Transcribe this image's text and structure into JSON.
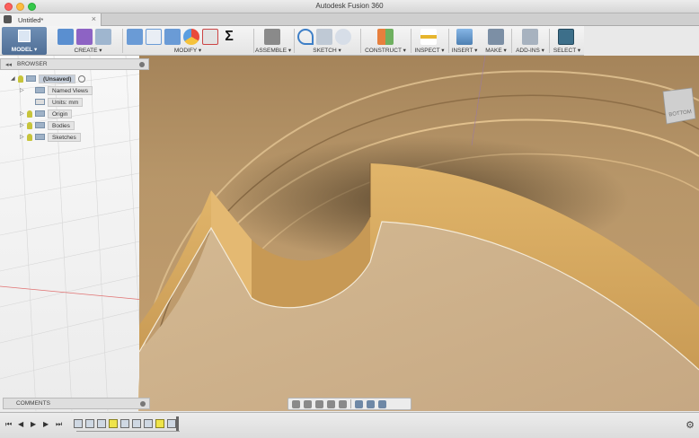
{
  "window": {
    "title": "Autodesk Fusion 360"
  },
  "tab": {
    "name": "Untitled*",
    "close": "×"
  },
  "workspace": {
    "label": "MODEL ▾"
  },
  "toolbar_groups": [
    {
      "label": "CREATE ▾"
    },
    {
      "label": "MODIFY ▾"
    },
    {
      "label": "ASSEMBLE ▾"
    },
    {
      "label": "SKETCH ▾"
    },
    {
      "label": "CONSTRUCT ▾"
    },
    {
      "label": "INSPECT ▾"
    },
    {
      "label": "INSERT ▾"
    },
    {
      "label": "MAKE ▾"
    },
    {
      "label": "ADD-INS ▾"
    },
    {
      "label": "SELECT ▾"
    }
  ],
  "toolbar_glyphs": {
    "sigma": "Σ"
  },
  "browser": {
    "title": "BROWSER",
    "collapse": "◂◂",
    "root": "(Unsaved)",
    "items": [
      {
        "label": "Named Views"
      },
      {
        "label": "Units: mm"
      },
      {
        "label": "Origin"
      },
      {
        "label": "Bodies"
      },
      {
        "label": "Sketches"
      }
    ],
    "tri_open": "◢",
    "tri_closed": "▷"
  },
  "viewcube": {
    "face": "BOTTOM"
  },
  "comments": {
    "title": "COMMENTS"
  },
  "timeline": {
    "first": "⏮",
    "prev": "◀",
    "play": "▶",
    "next": "▶",
    "last": "⏭",
    "settings": "⚙"
  },
  "colors": {
    "ws_accent": "#4f6e96",
    "surface": "#c8a87f",
    "wall": "#d8ad60",
    "highlight_feature": "#efe44a",
    "select_active": "#3d6f8a"
  }
}
